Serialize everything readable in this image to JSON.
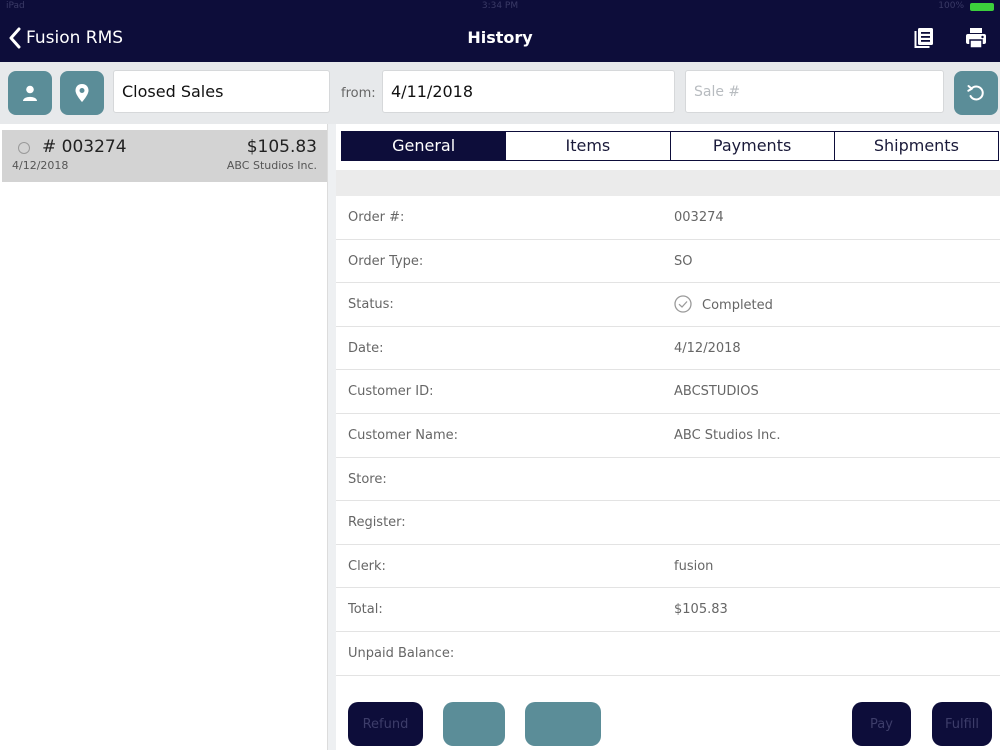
{
  "status_bar": {
    "carrier": "iPad",
    "time": "3:34 PM",
    "battery": "100%"
  },
  "nav": {
    "back_label": "Fusion RMS",
    "title": "History"
  },
  "filters": {
    "sale_type": "Closed Sales",
    "from_label": "from:",
    "from_date": "4/11/2018",
    "sale_number_placeholder": "Sale #"
  },
  "sales_list": [
    {
      "order": "# 003274",
      "total": "$105.83",
      "date": "4/12/2018",
      "customer": "ABC Studios Inc."
    }
  ],
  "tabs": [
    {
      "label": "General",
      "active": true
    },
    {
      "label": "Items",
      "active": false
    },
    {
      "label": "Payments",
      "active": false
    },
    {
      "label": "Shipments",
      "active": false
    }
  ],
  "details": [
    {
      "label": "Order #:",
      "value": "003274"
    },
    {
      "label": "Order Type:",
      "value": "SO"
    },
    {
      "label": "Status:",
      "value": "Completed"
    },
    {
      "label": "Date:",
      "value": "4/12/2018"
    },
    {
      "label": "Customer ID:",
      "value": "ABCSTUDIOS"
    },
    {
      "label": "Customer Name:",
      "value": "ABC Studios Inc."
    },
    {
      "label": "Store:",
      "value": ""
    },
    {
      "label": "Register:",
      "value": ""
    },
    {
      "label": "Clerk:",
      "value": "fusion"
    },
    {
      "label": "Total:",
      "value": "$105.83"
    },
    {
      "label": "Unpaid Balance:",
      "value": ""
    }
  ],
  "actions": {
    "refund": "Refund",
    "blank1": "",
    "blank2": "",
    "pay": "Pay",
    "fulfill": "Fulfill"
  },
  "colors": {
    "navy": "#0d0d3a",
    "teal": "#5b8d98",
    "battery": "#3ccf3c"
  }
}
